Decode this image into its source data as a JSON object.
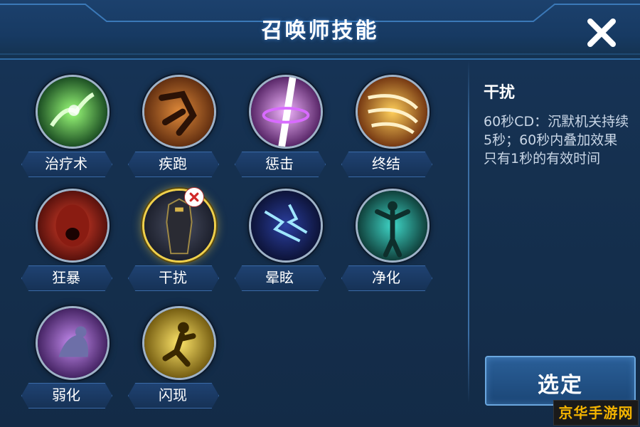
{
  "header": {
    "title": "召唤师技能"
  },
  "skills": [
    {
      "label": "治疗术",
      "icon": "heal-icon"
    },
    {
      "label": "疾跑",
      "icon": "sprint-icon"
    },
    {
      "label": "惩击",
      "icon": "smite-icon"
    },
    {
      "label": "终结",
      "icon": "execute-icon"
    },
    {
      "label": "狂暴",
      "icon": "rage-icon"
    },
    {
      "label": "干扰",
      "icon": "disrupt-icon",
      "selected": true,
      "forbidden": true
    },
    {
      "label": "晕眩",
      "icon": "stun-icon"
    },
    {
      "label": "净化",
      "icon": "purify-icon"
    },
    {
      "label": "弱化",
      "icon": "weaken-icon"
    },
    {
      "label": "闪现",
      "icon": "flash-icon"
    }
  ],
  "detail": {
    "name": "干扰",
    "description": "60秒CD：沉默机关持续5秒；60秒内叠加效果只有1秒的有效时间"
  },
  "actions": {
    "select_label": "选定"
  },
  "watermark": "京华手游网",
  "colors": {
    "accent": "#f0d04a",
    "panel": "#15304f",
    "button": "#1b4676"
  }
}
